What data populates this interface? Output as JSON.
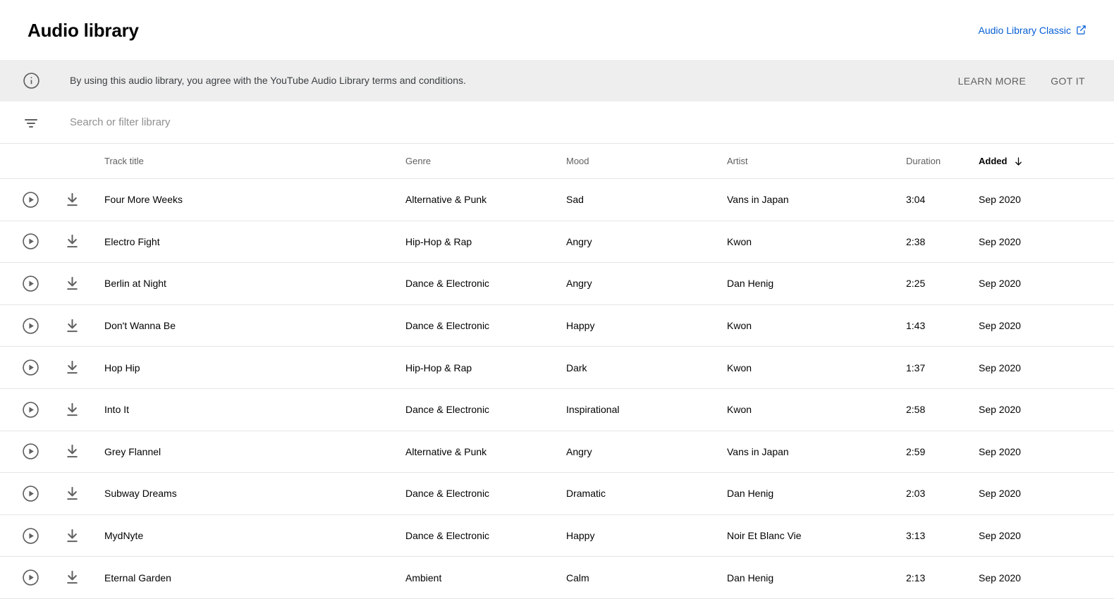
{
  "header": {
    "title": "Audio library",
    "classic_link_label": "Audio Library Classic",
    "classic_link_icon": "external-link-icon",
    "link_color": "#065fd4"
  },
  "notice": {
    "icon": "info-icon",
    "text": "By using this audio library, you agree with the YouTube Audio Library terms and conditions.",
    "learn_more_label": "LEARN MORE",
    "got_it_label": "GOT IT",
    "background_color": "#eeeeee"
  },
  "search": {
    "icon": "filter-icon",
    "value": "",
    "placeholder": "Search or filter library"
  },
  "table": {
    "columns": {
      "title": "Track title",
      "genre": "Genre",
      "mood": "Mood",
      "artist": "Artist",
      "duration": "Duration",
      "added": "Added"
    },
    "sort": {
      "column": "Added",
      "direction": "descending",
      "icon": "arrow-down-icon"
    },
    "row_icons": {
      "play": "play-circle-icon",
      "download": "download-icon"
    },
    "rows": [
      {
        "title": "Four More Weeks",
        "genre": "Alternative & Punk",
        "mood": "Sad",
        "artist": "Vans in Japan",
        "duration": "3:04",
        "added": "Sep 2020"
      },
      {
        "title": "Electro Fight",
        "genre": "Hip-Hop & Rap",
        "mood": "Angry",
        "artist": "Kwon",
        "duration": "2:38",
        "added": "Sep 2020"
      },
      {
        "title": "Berlin at Night",
        "genre": "Dance & Electronic",
        "mood": "Angry",
        "artist": "Dan Henig",
        "duration": "2:25",
        "added": "Sep 2020"
      },
      {
        "title": "Don't Wanna Be",
        "genre": "Dance & Electronic",
        "mood": "Happy",
        "artist": "Kwon",
        "duration": "1:43",
        "added": "Sep 2020"
      },
      {
        "title": "Hop Hip",
        "genre": "Hip-Hop & Rap",
        "mood": "Dark",
        "artist": "Kwon",
        "duration": "1:37",
        "added": "Sep 2020"
      },
      {
        "title": "Into It",
        "genre": "Dance & Electronic",
        "mood": "Inspirational",
        "artist": "Kwon",
        "duration": "2:58",
        "added": "Sep 2020"
      },
      {
        "title": "Grey Flannel",
        "genre": "Alternative & Punk",
        "mood": "Angry",
        "artist": "Vans in Japan",
        "duration": "2:59",
        "added": "Sep 2020"
      },
      {
        "title": "Subway Dreams",
        "genre": "Dance & Electronic",
        "mood": "Dramatic",
        "artist": "Dan Henig",
        "duration": "2:03",
        "added": "Sep 2020"
      },
      {
        "title": "MydNyte",
        "genre": "Dance & Electronic",
        "mood": "Happy",
        "artist": "Noir Et Blanc Vie",
        "duration": "3:13",
        "added": "Sep 2020"
      },
      {
        "title": "Eternal Garden",
        "genre": "Ambient",
        "mood": "Calm",
        "artist": "Dan Henig",
        "duration": "2:13",
        "added": "Sep 2020"
      }
    ]
  }
}
